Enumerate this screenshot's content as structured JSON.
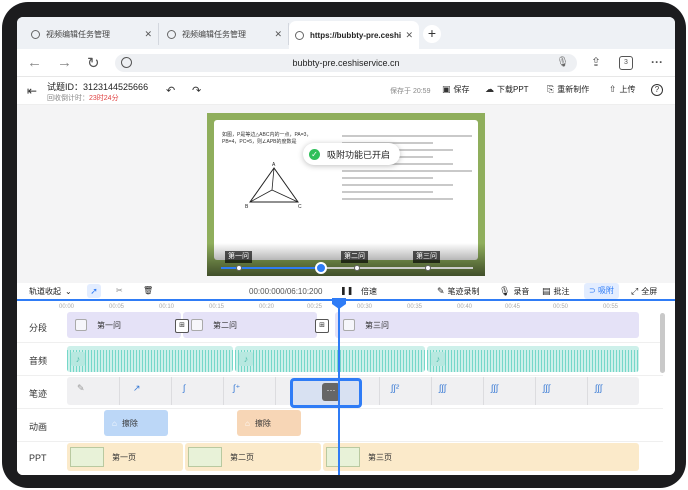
{
  "browser": {
    "tabs": [
      {
        "label": "视频编辑任务管理"
      },
      {
        "label": "视频编辑任务管理"
      },
      {
        "label": "https://bubbty-pre.ceshi"
      }
    ],
    "url": "bubbty-pre.ceshiservice.cn",
    "tab_count": "3"
  },
  "header": {
    "question_id": "试题ID：3123144525666",
    "countdown_label": "回收倒计时：",
    "countdown_value": "23时24分",
    "saved_at": "保存于 20:59",
    "save_label": "保存",
    "download_label": "下载PPT",
    "remake_label": "重新制作",
    "upload_label": "上传"
  },
  "preview": {
    "toast": "吸附功能已开启",
    "problem_text": "如图，P是等边△ABC内的一点，PA=3，PB=4，PC=5，则∠APB的度数是",
    "vertex_labels": [
      "A",
      "B",
      "C"
    ],
    "segment_marks": [
      "第一问",
      "第二问",
      "第三问"
    ]
  },
  "toolbar": {
    "track_collapse": "轨道收起",
    "time": "00:00:000/06:10:200",
    "speed": "倍速",
    "pen_record": "笔迹录制",
    "record": "录音",
    "annotate": "批注",
    "adsorb": "吸附",
    "fullscreen": "全屏"
  },
  "timeline": {
    "ticks": [
      "00:00",
      "00:05",
      "00:10",
      "00:15",
      "00:20",
      "00:25",
      "00:30",
      "00:35",
      "00:40",
      "00:45",
      "00:50",
      "00:55"
    ],
    "rows": [
      "分段",
      "音频",
      "笔迹",
      "动画",
      "PPT"
    ],
    "segments": [
      "第一问",
      "第二问",
      "第三问"
    ],
    "animations": [
      "擦除",
      "擦除"
    ],
    "ppt_pages": [
      "第一页",
      "第二页",
      "第三页"
    ]
  },
  "colors": {
    "accent": "#2f7cf6",
    "segment_bg": "#e5e2f7",
    "audio_bg": "#cdf0ea",
    "ppt_bg": "#fbeaca",
    "anim_blue": "#bcd7f7",
    "anim_orange": "#f7d6b6",
    "countdown": "#e04040"
  }
}
